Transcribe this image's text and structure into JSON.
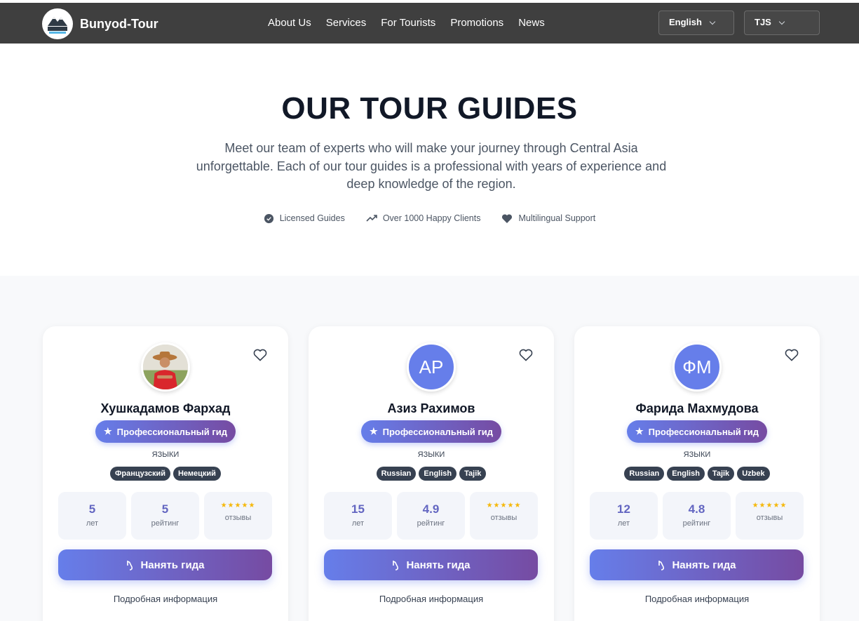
{
  "header": {
    "brand": "Bunyod-Tour",
    "logo_text": "Bunyod-Tour",
    "nav": [
      "About Us",
      "Services",
      "For Tourists",
      "Promotions",
      "News"
    ],
    "language": "English",
    "currency": "TJS"
  },
  "hero": {
    "title": "OUR TOUR GUIDES",
    "subtitle": "Meet our team of experts who will make your journey through Central Asia unforgettable. Each of our tour guides is a professional with years of experience and deep knowledge of the region.",
    "features": [
      {
        "icon": "check-badge-icon",
        "label": "Licensed Guides"
      },
      {
        "icon": "trending-up-icon",
        "label": "Over 1000 Happy Clients"
      },
      {
        "icon": "heart-icon",
        "label": "Multilingual Support"
      }
    ]
  },
  "colors": {
    "accent_start": "#667eea",
    "accent_end": "#764ba2",
    "header_bg": "#3f3f3f"
  },
  "guides": [
    {
      "name": "Хушкадамов Фархад",
      "initials": "",
      "badge": "Профессиональный гид",
      "languages_label": "ЯЗЫКИ",
      "languages": [
        "Французский",
        "Немецкий"
      ],
      "years": "5",
      "years_label": "лет",
      "rating": "5",
      "rating_label": "рейтинг",
      "stars": "★★★★★",
      "reviews_label": "отзывы",
      "hire": "Нанять гида",
      "details": "Подробная информация"
    },
    {
      "name": "Азиз Рахимов",
      "initials": "AP",
      "badge": "Профессиональный гид",
      "languages_label": "ЯЗЫКИ",
      "languages": [
        "Russian",
        "English",
        "Tajik"
      ],
      "years": "15",
      "years_label": "лет",
      "rating": "4.9",
      "rating_label": "рейтинг",
      "stars": "★★★★★",
      "reviews_label": "отзывы",
      "hire": "Нанять гида",
      "details": "Подробная информация"
    },
    {
      "name": "Фарида Махмудова",
      "initials": "ФМ",
      "badge": "Профессиональный гид",
      "languages_label": "ЯЗЫКИ",
      "languages": [
        "Russian",
        "English",
        "Tajik",
        "Uzbek"
      ],
      "years": "12",
      "years_label": "лет",
      "rating": "4.8",
      "rating_label": "рейтинг",
      "stars": "★★★★★",
      "reviews_label": "отзывы",
      "hire": "Нанять гида",
      "details": "Подробная информация"
    }
  ]
}
